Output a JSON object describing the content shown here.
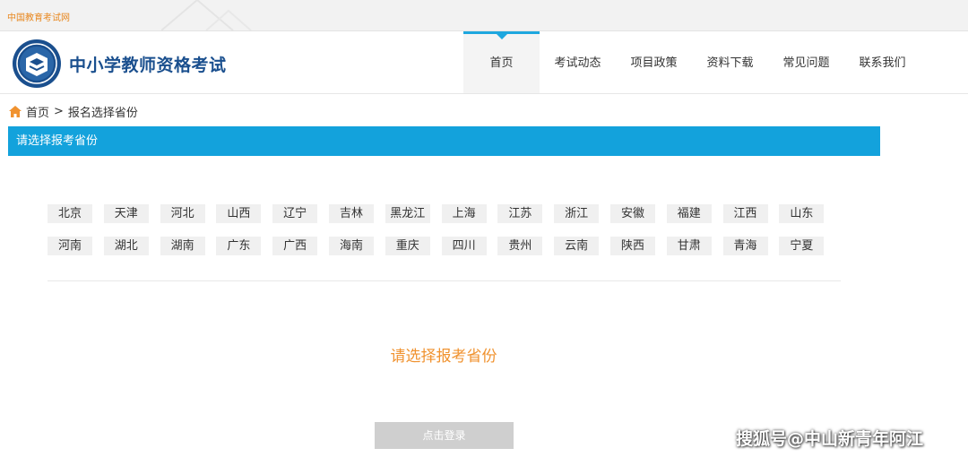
{
  "topbar": {
    "site_link": "中国教育考试网"
  },
  "header": {
    "brand": "中小学教师资格考试",
    "nav": [
      {
        "label": "首页",
        "active": true
      },
      {
        "label": "考试动态",
        "active": false
      },
      {
        "label": "项目政策",
        "active": false
      },
      {
        "label": "资料下载",
        "active": false
      },
      {
        "label": "常见问题",
        "active": false
      },
      {
        "label": "联系我们",
        "active": false
      }
    ]
  },
  "breadcrumb": {
    "home": "首页",
    "separator": ">",
    "current": "报名选择省份"
  },
  "section": {
    "title": "请选择报考省份"
  },
  "provinces": {
    "row1": [
      "北京",
      "天津",
      "河北",
      "山西",
      "辽宁",
      "吉林",
      "黑龙江",
      "上海",
      "江苏",
      "浙江",
      "安徽",
      "福建",
      "江西",
      "山东"
    ],
    "row2": [
      "河南",
      "湖北",
      "湖南",
      "广东",
      "广西",
      "海南",
      "重庆",
      "四川",
      "贵州",
      "云南",
      "陕西",
      "甘肃",
      "青海",
      "宁夏"
    ]
  },
  "prompt": "请选择报考省份",
  "login_button": "点击登录",
  "watermark": "搜狐号@中山新青年阿江",
  "colors": {
    "accent": "#13a2dc",
    "brand_text": "#1a4f8e",
    "prompt": "#f0922f",
    "link": "#e8871e"
  }
}
